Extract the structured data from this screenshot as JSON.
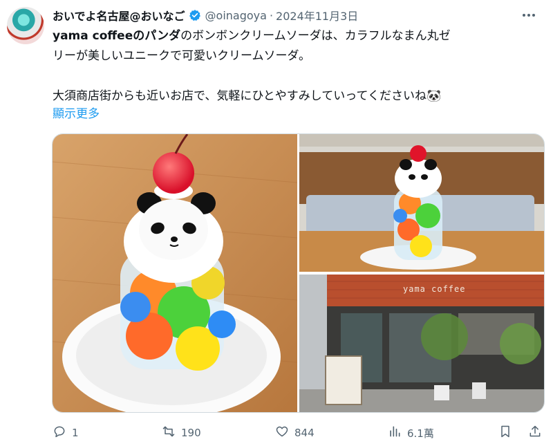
{
  "user": {
    "display_name": "おいでよ名古屋@おいなご",
    "handle": "@oinagoya",
    "separator": "·",
    "date": "2024年11月3日"
  },
  "tweet": {
    "line1_prefix": "yama coffeeの",
    "line1_bold": "パンダ",
    "line1_suffix": "のボンボンクリームソーダは、カラフルなまん丸ゼ",
    "line2": "リーが美しいユニークで可愛いクリームソーダ。",
    "line3": "大須商店街からも近いお店で、気軽にひとやすみしていってくださいね🐼",
    "show_more": "顯示更多"
  },
  "media": {
    "sign_text": "yama coffee"
  },
  "actions": {
    "reply_count": "1",
    "retweet_count": "190",
    "like_count": "844",
    "view_count": "6.1萬"
  },
  "colors": {
    "accent": "#1d9bf0",
    "muted": "#536471",
    "text": "#0f1419",
    "border": "#cfd9de"
  },
  "icons": [
    "verified-badge-icon",
    "more-icon",
    "reply-icon",
    "retweet-icon",
    "like-icon",
    "views-icon",
    "bookmark-icon",
    "share-icon"
  ]
}
